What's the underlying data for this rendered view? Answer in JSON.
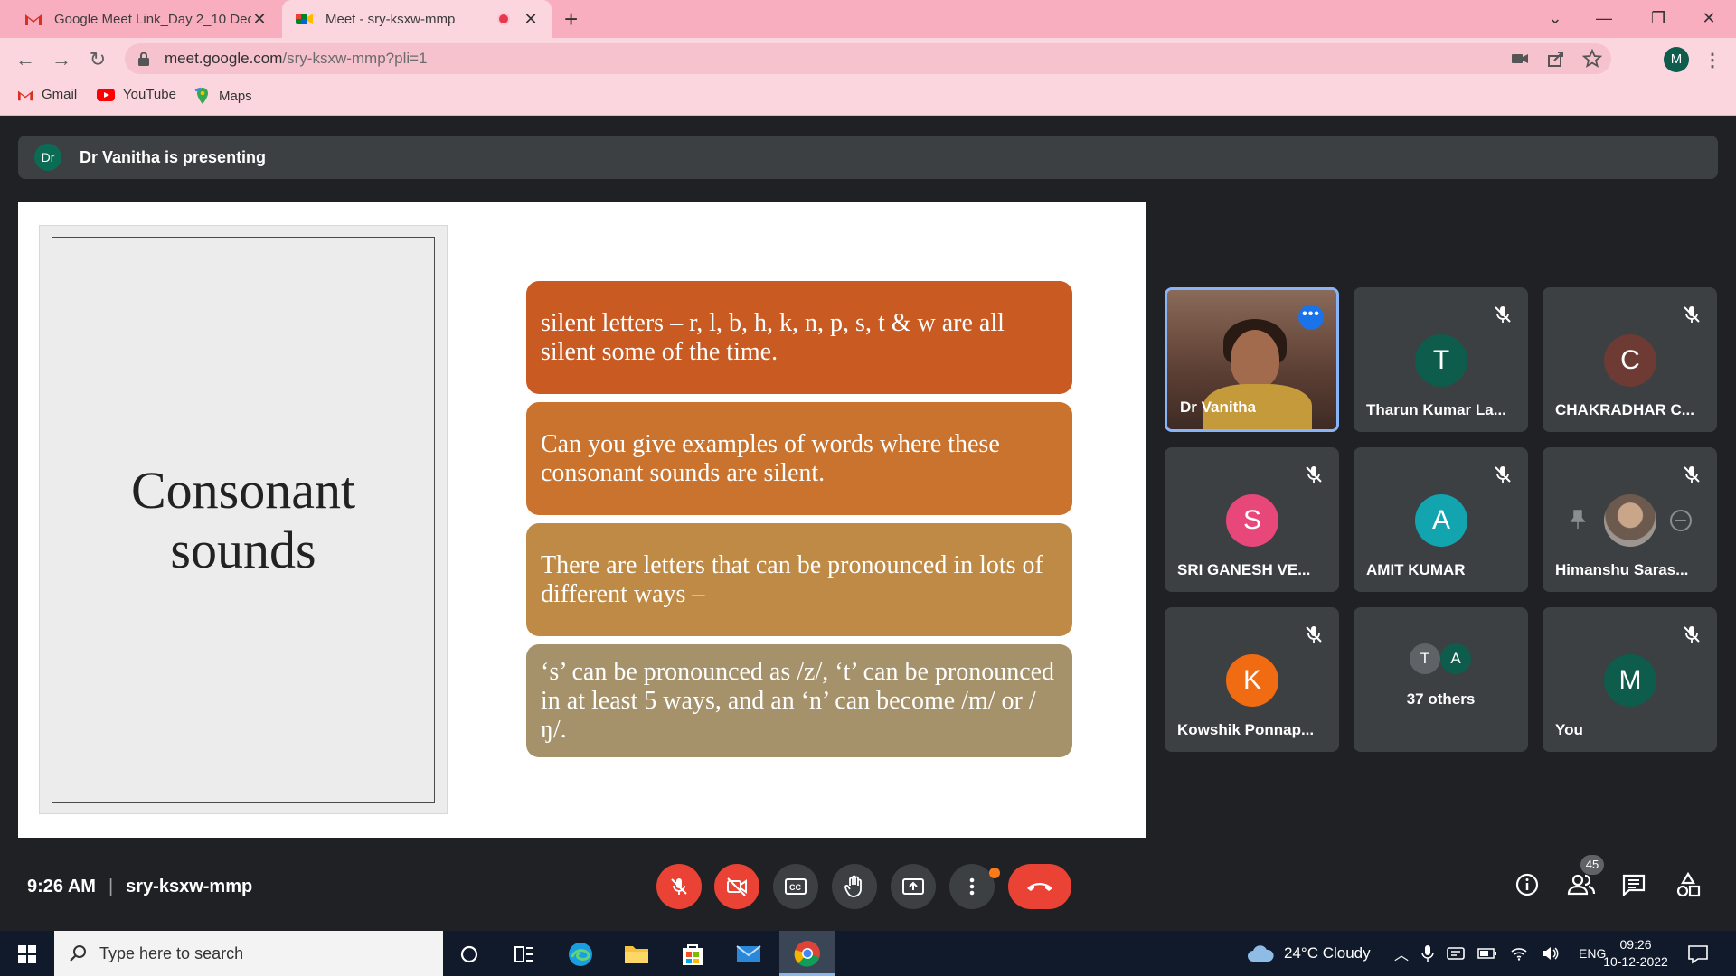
{
  "browser": {
    "tabs": [
      {
        "title": "Google Meet Link_Day 2_10 Dec",
        "favicon": "gmail-icon"
      },
      {
        "title": "Meet - sry-ksxw-mmp",
        "favicon": "meet-icon"
      }
    ],
    "url_host": "meet.google.com",
    "url_path": "/sry-ksxw-mmp?pli=1",
    "profile_initial": "M",
    "bookmarks": [
      "Gmail",
      "YouTube",
      "Maps"
    ]
  },
  "meet": {
    "presenter_initials": "Dr",
    "presenting_text": "Dr Vanitha is presenting",
    "slide": {
      "title_line1": "Consonant",
      "title_line2": "sounds",
      "cards": [
        "silent letters – r, l, b, h, k, n, p, s, t & w are all silent some of the time.",
        "Can you give examples of words where these consonant sounds are silent.",
        "There are letters that can be pronounced in lots of different ways –",
        "‘s’ can be pronounced as /z/, ‘t’ can be pronounced in at least 5 ways, and an ‘n’ can become /m/ or /ŋ/."
      ]
    },
    "participants": [
      {
        "name": "Dr Vanitha",
        "type": "video"
      },
      {
        "name": "Tharun Kumar La...",
        "initial": "T",
        "color": "#0d5c4c",
        "muted": true
      },
      {
        "name": "CHAKRADHAR C...",
        "initial": "C",
        "color": "#6d3b33",
        "muted": true
      },
      {
        "name": "SRI GANESH VE...",
        "initial": "S",
        "color": "#e8477a",
        "muted": true
      },
      {
        "name": "AMIT KUMAR",
        "initial": "A",
        "color": "#12a4af",
        "muted": true
      },
      {
        "name": "Himanshu Saras...",
        "type": "photo",
        "muted": true
      },
      {
        "name": "Kowshik Ponnap...",
        "initial": "K",
        "color": "#f06b12",
        "muted": true
      },
      {
        "name": "37 others",
        "type": "others",
        "initials": [
          "T",
          "A"
        ]
      },
      {
        "name": "You",
        "initial": "M",
        "color": "#0d5c4c",
        "muted": true
      }
    ],
    "time": "9:26 AM",
    "meeting_code": "sry-ksxw-mmp",
    "people_count": "45"
  },
  "taskbar": {
    "search_placeholder": "Type here to search",
    "weather": "24°C  Cloudy",
    "language": "ENG",
    "clock_time": "09:26",
    "clock_date": "10-12-2022"
  },
  "colors": {
    "chrome_tab_strip": "#f8aebe",
    "chrome_toolbar": "#fcd6df",
    "meet_bg": "#202124",
    "meet_tile": "#3c4043",
    "end_call": "#ea4335"
  }
}
